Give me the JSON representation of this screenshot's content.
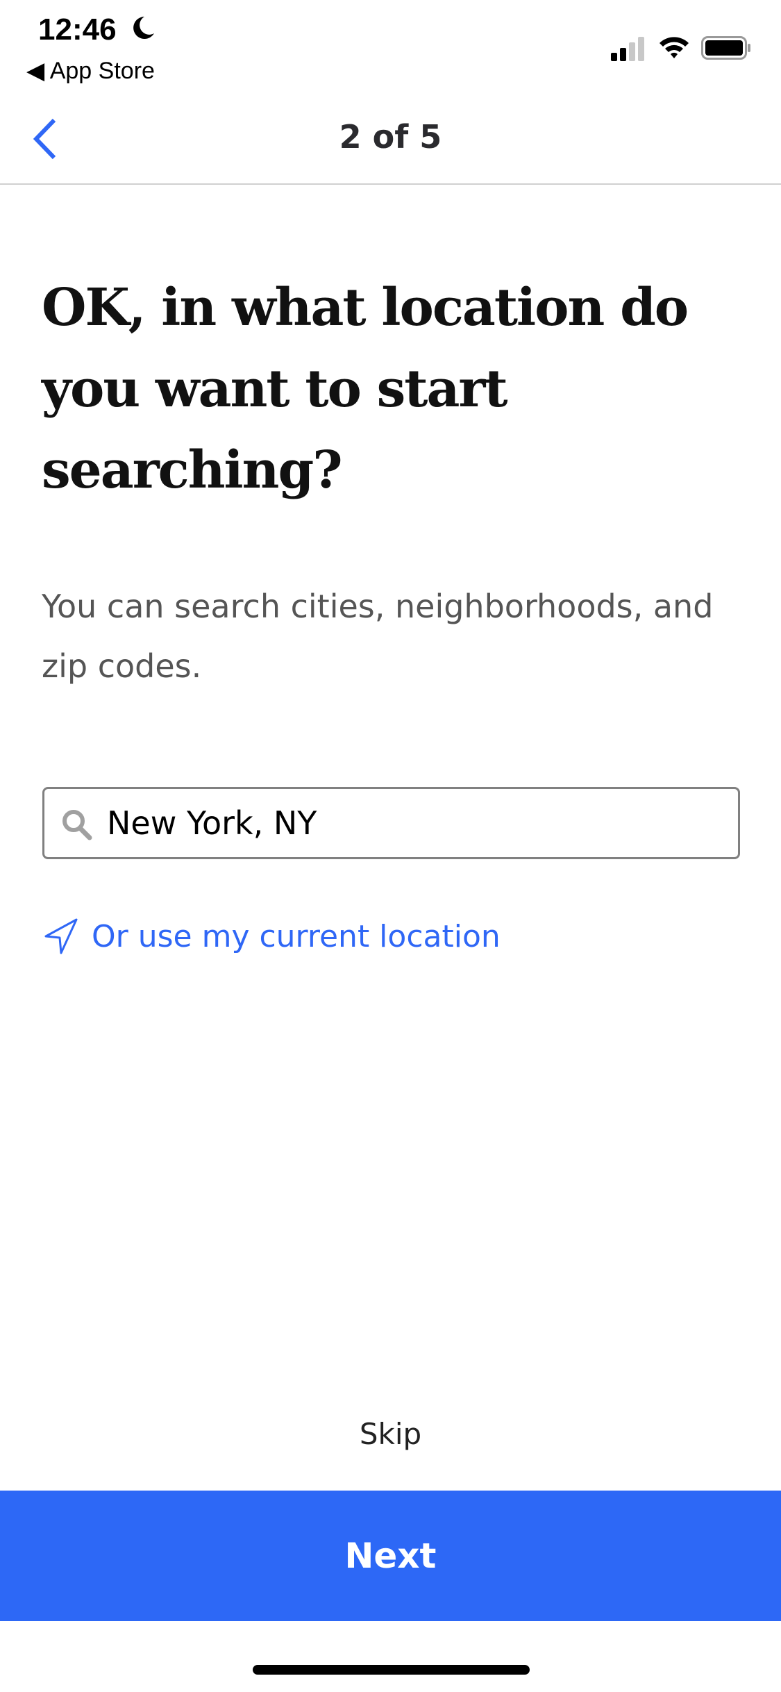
{
  "status_bar": {
    "time": "12:46",
    "back_app": "◀ App Store"
  },
  "nav": {
    "step": "2 of 5"
  },
  "heading": "OK, in what location do you want to start searching?",
  "subtitle": "You can search cities, neighborhoods, and zip codes.",
  "search": {
    "value": "New York, NY"
  },
  "location_link": "Or use my current location",
  "skip_label": "Skip",
  "next_label": "Next",
  "colors": {
    "accent": "#2d68f6",
    "link": "#2f67f6",
    "heading": "#111111",
    "subtitle": "#555555"
  }
}
